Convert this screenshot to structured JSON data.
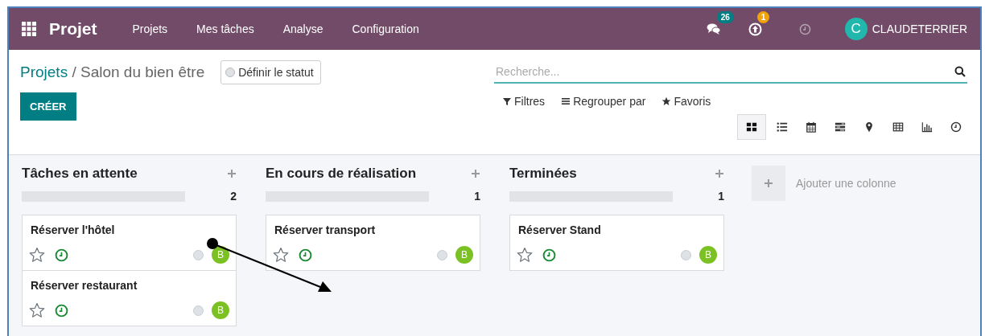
{
  "navbar": {
    "app_name": "Projet",
    "menu": [
      "Projets",
      "Mes tâches",
      "Analyse",
      "Configuration"
    ],
    "messages_badge": "26",
    "activities_badge": "1",
    "user_initial": "C",
    "user_name": "CLAUDETERRIER"
  },
  "breadcrumb": {
    "parent": "Projets",
    "separator": "/",
    "current": "Salon du bien être"
  },
  "status_button": "Définir le statut",
  "create_button": "CRÉER",
  "search": {
    "placeholder": "Recherche..."
  },
  "filters": [
    {
      "kind": "filter",
      "label": "Filtres"
    },
    {
      "kind": "group",
      "label": "Regrouper par"
    },
    {
      "kind": "favorites",
      "label": "Favoris"
    }
  ],
  "views": [
    {
      "kind": "kanban",
      "selected": true
    },
    {
      "kind": "list",
      "selected": false
    },
    {
      "kind": "calendar",
      "selected": false
    },
    {
      "kind": "gantt",
      "selected": false
    },
    {
      "kind": "map",
      "selected": false
    },
    {
      "kind": "pivot",
      "selected": false
    },
    {
      "kind": "graph",
      "selected": false
    },
    {
      "kind": "activity",
      "selected": false
    }
  ],
  "columns": [
    {
      "title": "Tâches en attente",
      "count": "2",
      "cards": [
        {
          "title": "Réserver l'hôtel",
          "starred": false,
          "ready": false,
          "assignee": "B"
        },
        {
          "title": "Réserver restaurant",
          "starred": false,
          "ready": false,
          "assignee": "B"
        }
      ]
    },
    {
      "title": "En cours de réalisation",
      "count": "1",
      "cards": [
        {
          "title": "Réserver transport",
          "starred": false,
          "ready": false,
          "assignee": "B"
        }
      ]
    },
    {
      "title": "Terminées",
      "count": "1",
      "cards": [
        {
          "title": "Réserver Stand",
          "starred": false,
          "ready": false,
          "assignee": "B"
        }
      ]
    }
  ],
  "add_column": "Ajouter une colonne",
  "drag_arrow": true
}
